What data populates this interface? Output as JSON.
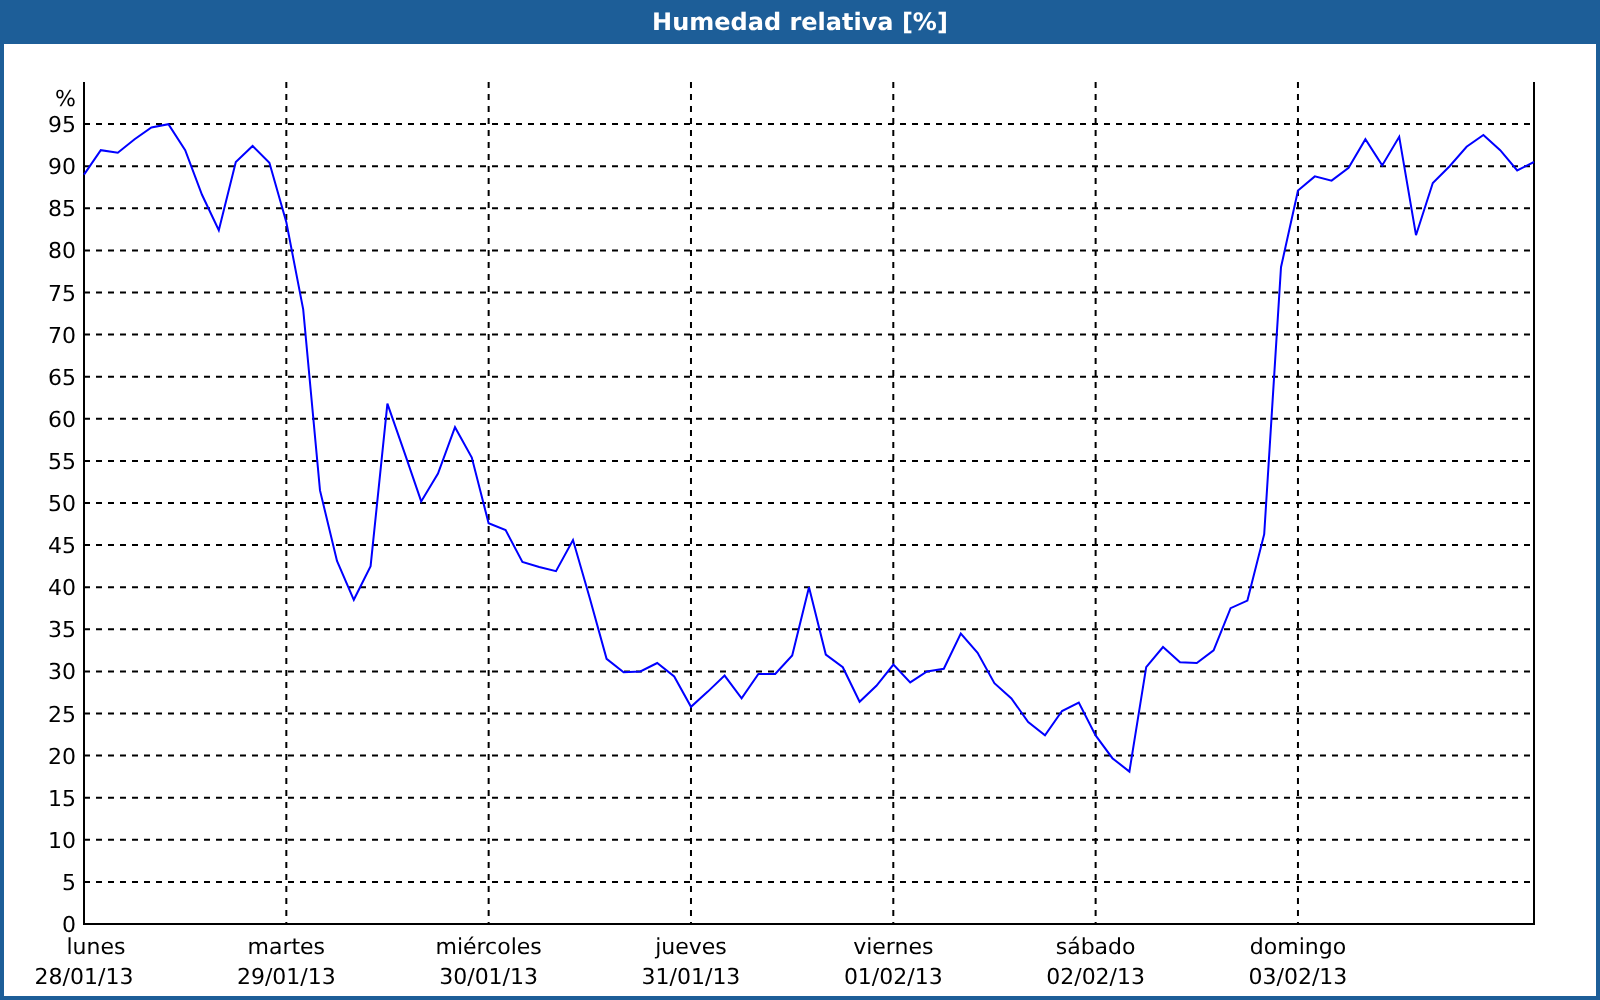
{
  "chart": {
    "chart_data": {
      "type": "line",
      "title": "Humedad relativa [%]",
      "ylabel": "%",
      "ylim": [
        0,
        100
      ],
      "grid": true,
      "yticks": [
        0,
        5,
        10,
        15,
        20,
        25,
        30,
        35,
        40,
        45,
        50,
        55,
        60,
        65,
        70,
        75,
        80,
        85,
        90,
        95
      ],
      "categories": [
        "lunes 28/01/13",
        null,
        null,
        null,
        null,
        null,
        null,
        null,
        null,
        null,
        null,
        null,
        "martes 29/01/13",
        null,
        null,
        null,
        null,
        null,
        null,
        null,
        null,
        null,
        null,
        null,
        "miércoles 30/01/13",
        null,
        null,
        null,
        null,
        null,
        null,
        null,
        null,
        null,
        null,
        null,
        "jueves 31/01/13",
        null,
        null,
        null,
        null,
        null,
        null,
        null,
        null,
        null,
        null,
        null,
        "viernes 01/02/13",
        null,
        null,
        null,
        null,
        null,
        null,
        null,
        null,
        null,
        null,
        null,
        "sábado 02/02/13",
        null,
        null,
        null,
        null,
        null,
        null,
        null,
        null,
        null,
        null,
        null,
        "domingo 03/02/13",
        null,
        null,
        null,
        null,
        null,
        null,
        null,
        null,
        null,
        null,
        null,
        null,
        null,
        null
      ],
      "series": [
        {
          "color": "#0000ff",
          "values": [
            89,
            91.9,
            91.6,
            93.2,
            94.6,
            95,
            91.9,
            86.6,
            82.4,
            90.5,
            92.4,
            90.4,
            83.3,
            73,
            51.5,
            43.1,
            38.5,
            42.5,
            61.8,
            56,
            50.2,
            53.5,
            59,
            55.4,
            47.6,
            46.8,
            43,
            42.4,
            41.9,
            45.6,
            38.7,
            31.5,
            29.9,
            30,
            31,
            29.4,
            25.8,
            27.6,
            29.5,
            26.8,
            29.7,
            29.7,
            31.9,
            40,
            32,
            30.5,
            26.4,
            28.3,
            30.8,
            28.7,
            30,
            30.3,
            34.5,
            32.2,
            28.6,
            26.8,
            24,
            22.4,
            25.3,
            26.3,
            22.4,
            19.7,
            18.1,
            30.5,
            32.9,
            31.1,
            31,
            32.5,
            37.5,
            38.4,
            46.3,
            78,
            87.1,
            88.8,
            88.3,
            89.8,
            93.2,
            90.1,
            93.5,
            81.8,
            88,
            90,
            92.3,
            93.7,
            91.9,
            89.5,
            90.5
          ]
        }
      ]
    }
  }
}
